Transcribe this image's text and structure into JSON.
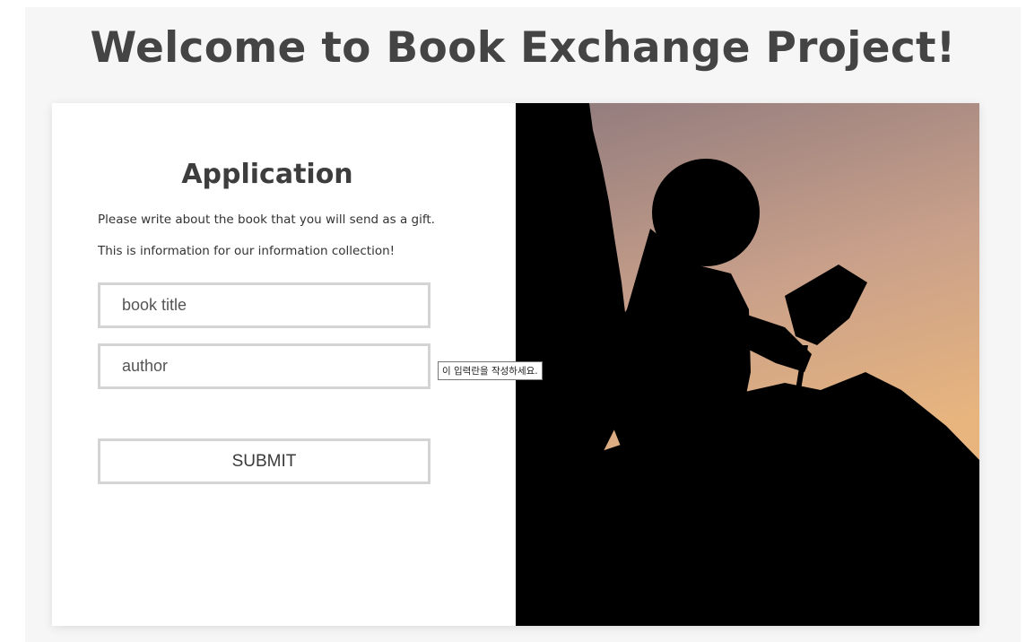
{
  "page": {
    "title": "Welcome to Book Exchange Project!"
  },
  "form": {
    "heading": "Application",
    "description_line1": "Please write about the book that you will send as a gift.",
    "description_line2": "This is information for our information collection!",
    "book_title": {
      "value": "",
      "placeholder": "book title"
    },
    "author": {
      "value": "",
      "placeholder": "author"
    },
    "submit_label": "SUBMIT",
    "validation_tooltip": "이 입력란을 작성하세요."
  },
  "image": {
    "subject": "silhouette of a child reading a book against a sunset sky",
    "colors": {
      "sky_top": "#8f7a7d",
      "sky_mid": "#c9a08a",
      "sky_glow": "#e8b57e",
      "silhouette": "#000000"
    }
  }
}
